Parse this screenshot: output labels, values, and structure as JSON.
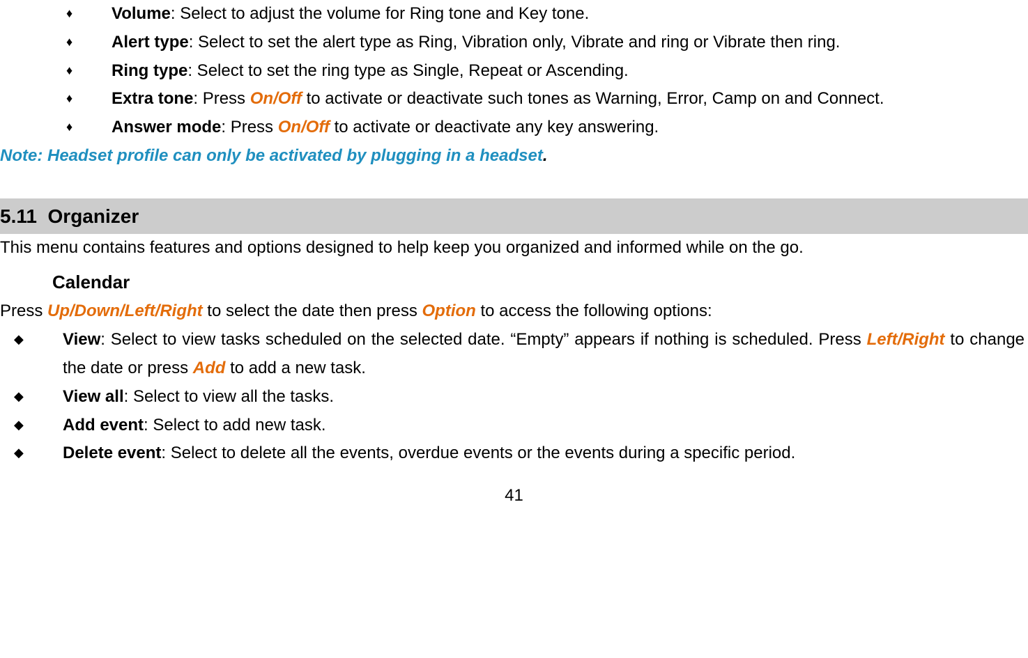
{
  "top_bullets": [
    {
      "label": "Volume",
      "text": ": Select to adjust the volume for Ring tone and Key tone."
    },
    {
      "label": "Alert type",
      "text": ": Select to set the alert type as Ring, Vibration only, Vibrate and ring or Vibrate then ring."
    },
    {
      "label": "Ring type",
      "text": ": Select to set the ring type as Single, Repeat or Ascending."
    },
    {
      "label": "Extra tone",
      "pre": ": Press ",
      "hl": "On/Off",
      "post": " to activate or deactivate such tones as Warning, Error, Camp on and Connect."
    },
    {
      "label": "Answer mode",
      "pre": ": Press ",
      "hl": "On/Off",
      "post": " to activate or deactivate any key answering."
    }
  ],
  "note": {
    "text": "Note: Headset profile can only be activated by plugging in a headset",
    "trail": "."
  },
  "section": {
    "num": "5.11",
    "title": "Organizer"
  },
  "intro": "This menu contains features and options designed to help keep you organized and informed while on the go.",
  "subhead": "Calendar",
  "cal_line": {
    "p1": "Press ",
    "h1": "Up/Down/Left/Right",
    "p2": " to select the date then press ",
    "h2": "Option",
    "p3": " to access the following options:"
  },
  "cal_bullets": {
    "view": {
      "label": "View",
      "p1": ": Select to view tasks scheduled on the selected date. “Empty” appears if nothing is scheduled. Press ",
      "h1": "Left/Right",
      "p2": " to change the date or press ",
      "h2": "Add",
      "p3": " to add a new task."
    },
    "viewall": {
      "label": "View all",
      "text": ": Select to view all the tasks."
    },
    "addevent": {
      "label": "Add event",
      "text": ": Select to add new task."
    },
    "delevent": {
      "label": "Delete event",
      "text": ": Select to delete all the events, overdue events or the events during a specific period."
    }
  },
  "pagenum": "41"
}
